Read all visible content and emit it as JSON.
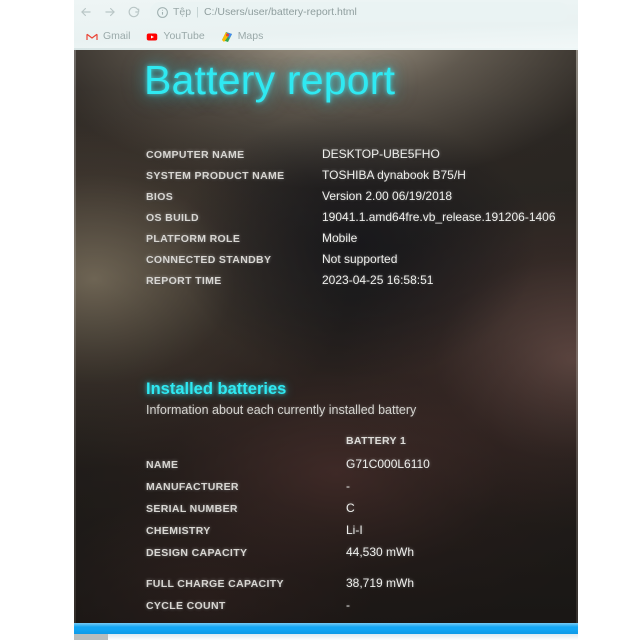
{
  "browser": {
    "nav": {
      "back_label": "←",
      "forward_label": "→",
      "reload_label": "⟳"
    },
    "omnibox": {
      "info_icon": "info-circle-icon",
      "scheme_label": "Tệp",
      "separator": "|",
      "url": "C:/Users/user/battery-report.html"
    },
    "bookmarks": [
      {
        "label": "Gmail",
        "icon": "gmail-icon"
      },
      {
        "label": "YouTube",
        "icon": "youtube-icon"
      },
      {
        "label": "Maps",
        "icon": "google-maps-icon"
      }
    ]
  },
  "report": {
    "title": "Battery report",
    "accent_color": "#2fe9f2",
    "system_info": [
      {
        "label": "COMPUTER NAME",
        "value": "DESKTOP-UBE5FHO"
      },
      {
        "label": "SYSTEM PRODUCT NAME",
        "value": "TOSHIBA dynabook B75/H"
      },
      {
        "label": "BIOS",
        "value": "Version 2.00 06/19/2018"
      },
      {
        "label": "OS BUILD",
        "value": "19041.1.amd64fre.vb_release.191206-1406"
      },
      {
        "label": "PLATFORM ROLE",
        "value": "Mobile"
      },
      {
        "label": "CONNECTED STANDBY",
        "value": "Not supported"
      },
      {
        "label": "REPORT TIME",
        "value": "2023-04-25  16:58:51"
      }
    ],
    "installed_batteries": {
      "heading": "Installed batteries",
      "subheading": "Information about each currently installed battery",
      "column_header": "BATTERY 1",
      "rows": [
        {
          "label": "NAME",
          "value": "G71C000L6110"
        },
        {
          "label": "MANUFACTURER",
          "value": "-"
        },
        {
          "label": "SERIAL NUMBER",
          "value": "C"
        },
        {
          "label": "CHEMISTRY",
          "value": "Li-I"
        },
        {
          "label": "DESIGN CAPACITY",
          "value": "44,530 mWh"
        },
        {
          "label": "FULL CHARGE CAPACITY",
          "value": "38,719 mWh"
        },
        {
          "label": "CYCLE COUNT",
          "value": "-"
        }
      ]
    }
  }
}
